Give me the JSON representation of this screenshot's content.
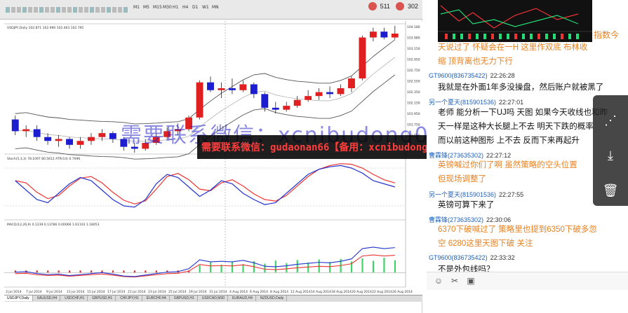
{
  "toolbar": {
    "buttons": [
      "M1",
      "M5",
      "M15",
      "M30",
      "H1",
      "H4",
      "D1",
      "W1",
      "MN"
    ],
    "stat1": "511",
    "stat2": "302"
  },
  "chart": {
    "header": "USDJPY,Daily  102.871 102.990 102.463 102.795",
    "price_labels": [
      "104.180",
      "103.980",
      "103.150",
      "102.950",
      "102.750",
      "102.550",
      "102.350",
      "102.150",
      "101.950",
      "101.750",
      "101.550",
      "101.350"
    ],
    "stoch_header": "Stoch(5,3,3) 78.1097 80.5612   ATR(14) 0.7096",
    "macd_header": "MACD(12,26,9)  0.1239  0.13786  0.00066  1.61103  1.18053",
    "date_labels": [
      "3 Jul 2014",
      "7 Jul 2014",
      "9 Jul 2014",
      "11 Jul 2014",
      "15 Jul 2014",
      "17 Jul 2014",
      "21 Jul 2014",
      "23 Jul 2014",
      "25 Jul 2014",
      "29 Jul 2014",
      "31 Jul 2014",
      "4 Aug 2014",
      "6 Aug 2014",
      "8 Aug 2014",
      "12 Aug 2014",
      "14 Aug 2014",
      "18 Aug 2014",
      "20 Aug 2014",
      "22 Aug 2014",
      "26 Aug 2014"
    ],
    "symbol_tabs": [
      "USDJPY,Daily",
      "XAUUSD,H4",
      "USDCHF,H1",
      "GBPUSD,H1",
      "CHFJPY,H1",
      "EURCHF,H4",
      "GBPUSD,H1",
      "USDCAD,M30",
      "EURAUD,H4",
      "NZDUSD,Daily"
    ]
  },
  "watermark": {
    "big": "需要联系微信：xcnibudong0105",
    "box": "需要联系微信：gudaonan66【备用：xcnibudong0105】"
  },
  "chat": {
    "top_right": "指数今",
    "messages": [
      {
        "type": "orange",
        "text": "天说过了   怀疑会在一H  这里作双底   布林收"
      },
      {
        "type": "orange",
        "text": "缩    顶背离也无力下行"
      },
      {
        "type": "meta",
        "user": "GT9600",
        "uid": "(836735422)",
        "time": "22:26:28"
      },
      {
        "type": "black",
        "text": "我就是在外面1年多没操盘，然后账户就被黑了"
      },
      {
        "type": "meta",
        "user": "另一个夏天",
        "uid": "(815901536)",
        "time": "22:27:01"
      },
      {
        "type": "black",
        "text": "老师   能分析一下UJ吗   天图 如果今天收线也和昨"
      },
      {
        "type": "black",
        "text": "天一样是这种大长腿上不去   明天下跌的概率"
      },
      {
        "type": "black",
        "text": "   而以前这种图形 上不去 反而下来再起升"
      },
      {
        "type": "meta",
        "user": "曹霖锋",
        "uid": "(273635302)",
        "time": "22:27:12"
      },
      {
        "type": "orange",
        "text": "英镑喊过你们了啊    虽然策略的空头位置"
      },
      {
        "type": "orange",
        "text": "但现场调整了"
      },
      {
        "type": "meta",
        "user": "另一个夏天",
        "uid": "(815901536)",
        "time": "22:27:55"
      },
      {
        "type": "black",
        "text": "英镑可算下来了"
      },
      {
        "type": "meta",
        "user": "曹霖锋",
        "uid": "(273635302)",
        "time": "22:30:06"
      },
      {
        "type": "orange",
        "text": "6370下破喊过了   策略里也提到6350下破多忽"
      },
      {
        "type": "orange",
        "text": "空  6280这里天图下破    关注"
      },
      {
        "type": "meta",
        "user": "GT9600",
        "uid": "(836735422)",
        "time": "22:33:32"
      },
      {
        "type": "black",
        "text": "不是外包线吗？"
      }
    ]
  },
  "icons": {
    "emoji": "☺",
    "scissors": "✂",
    "image": "▣",
    "share": "⋰",
    "download": "⤓",
    "trash": "🗑"
  }
}
